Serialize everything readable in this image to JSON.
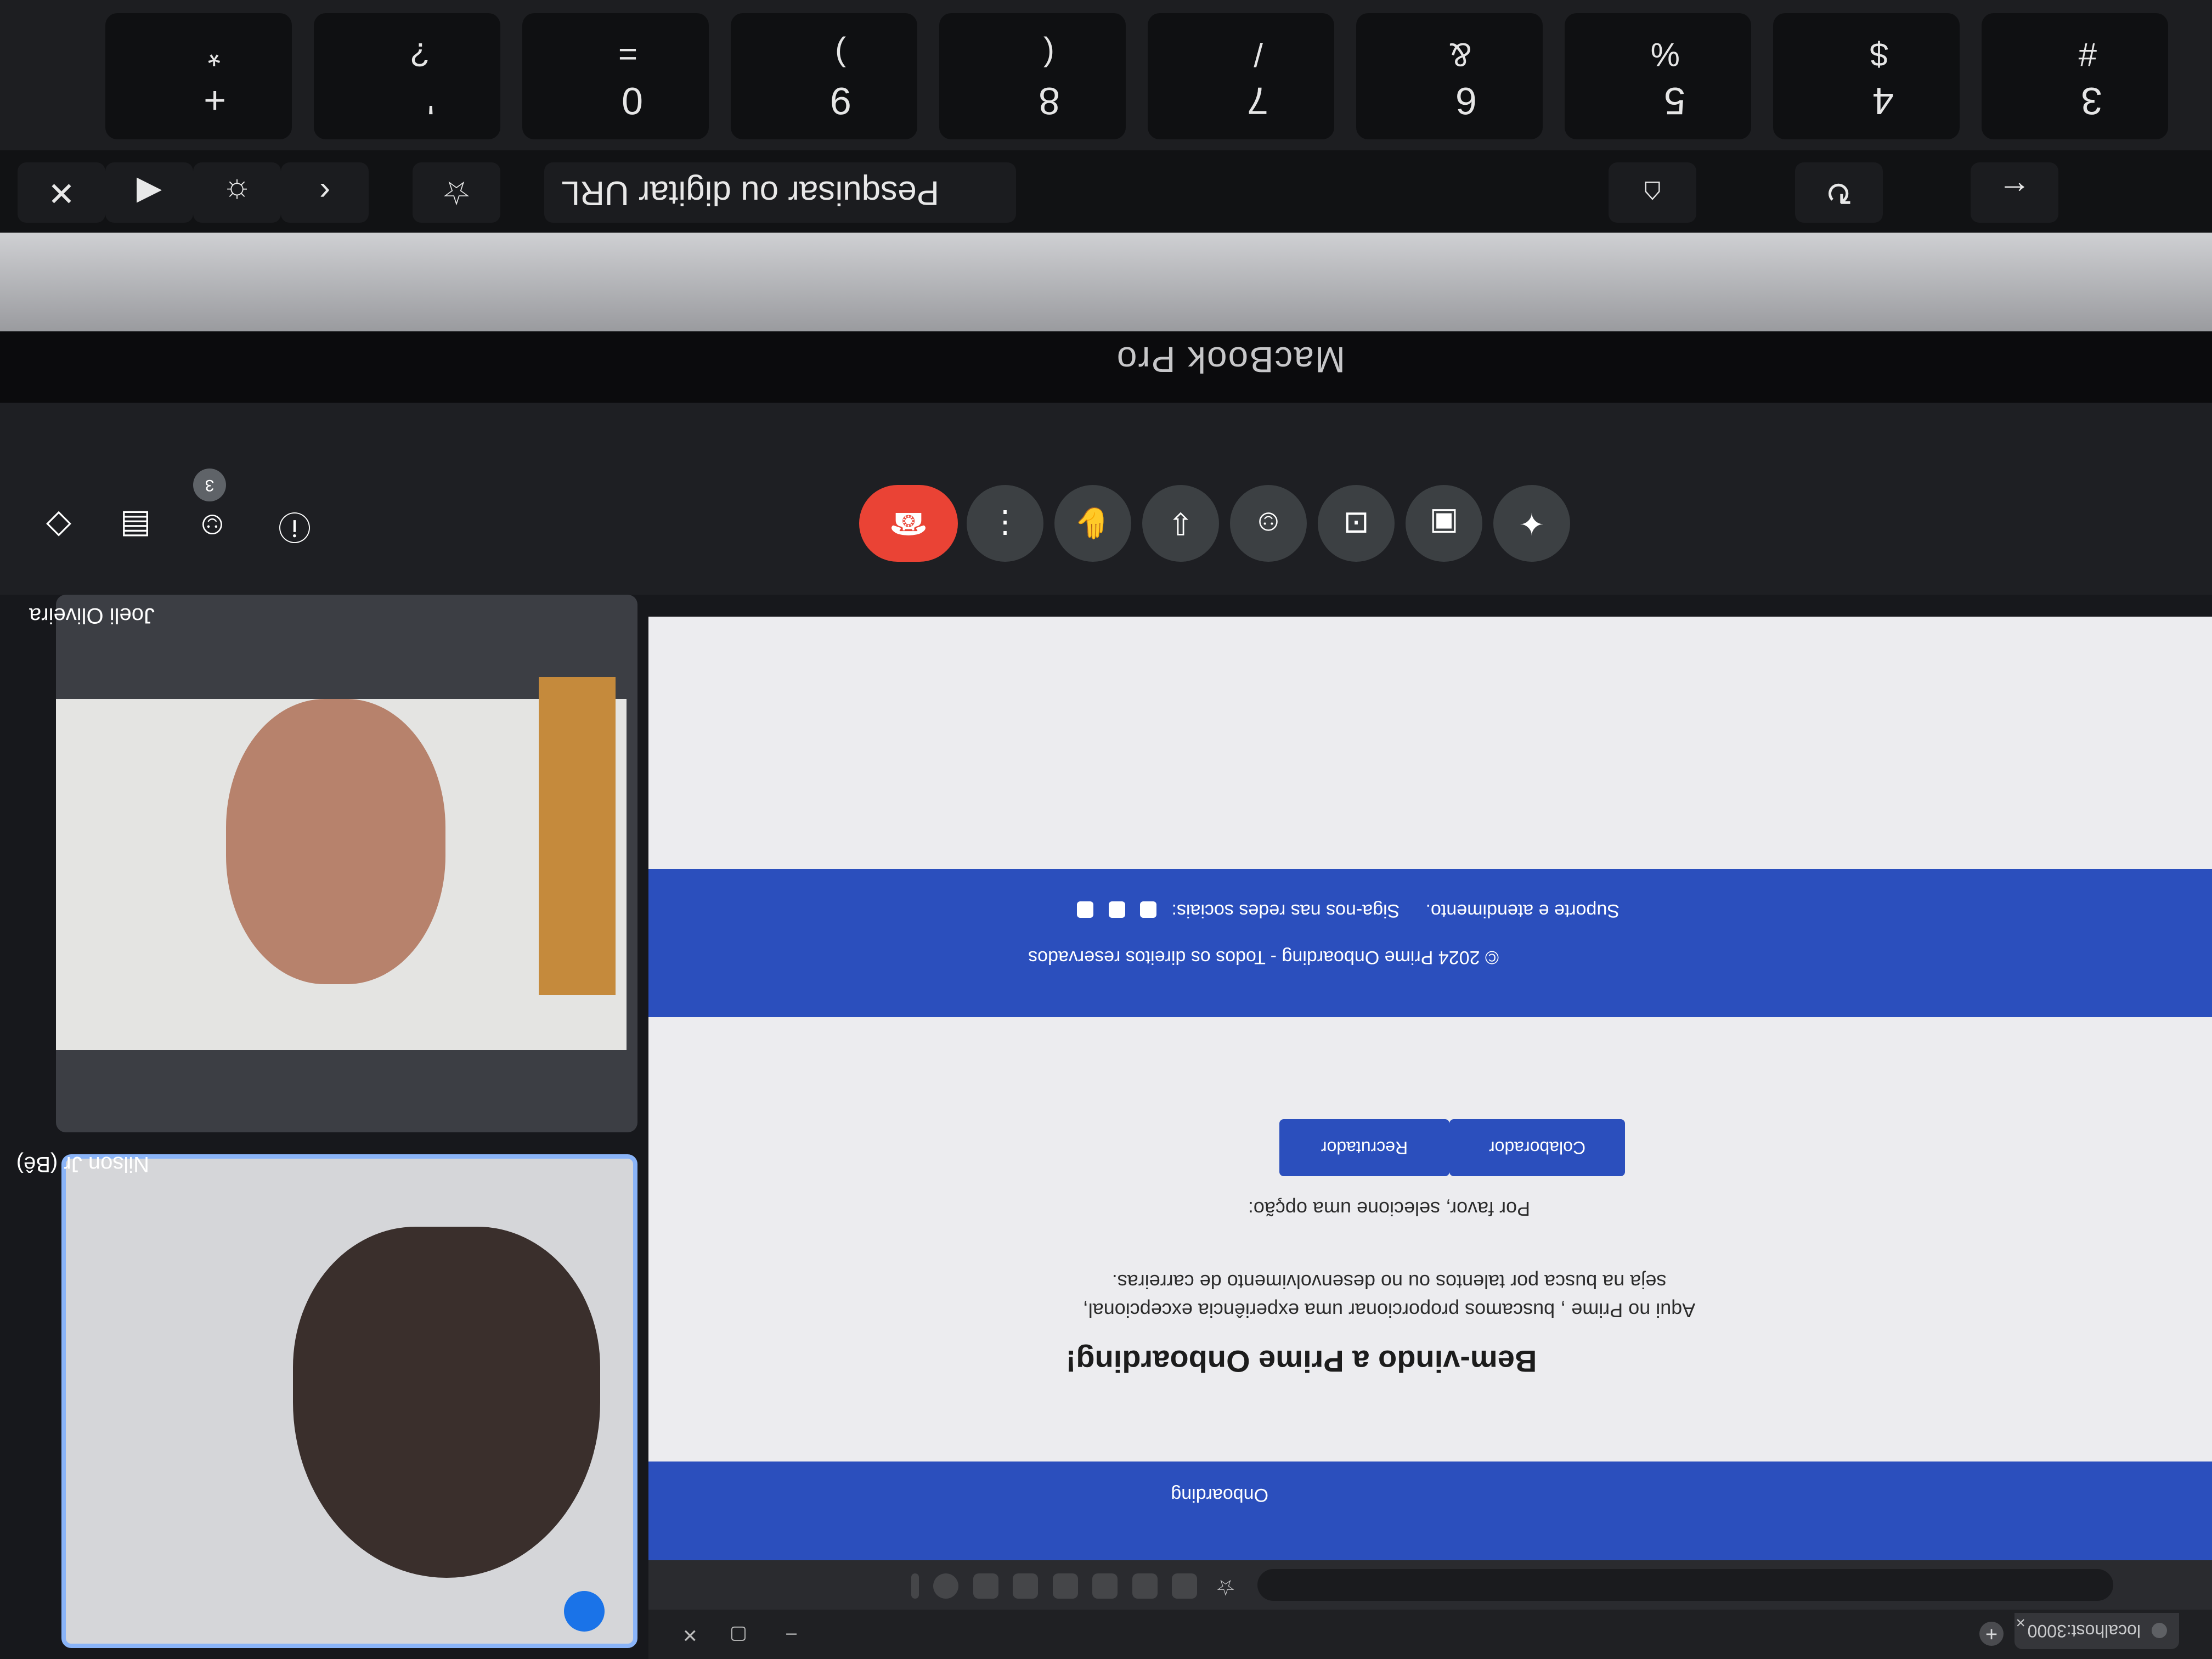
{
  "device": {
    "brand_label": "MacBook Pro"
  },
  "browser": {
    "tab_title": "localhost:3000",
    "omnibox_placeholder": "Pesquisar ou digitar URL"
  },
  "page": {
    "brand": "Onboarding",
    "hero_title": "Bem-vindo a Prime Onboarding!",
    "hero_description_line1": "Aqui no Prime , buscamos proporcionar uma experiência excepcional,",
    "hero_description_line2": "seja na busca por talentos ou no desenvolvimento de carreiras.",
    "prompt": "Por favor, selecione uma opção:",
    "buttons": {
      "recruiter": "Recrutador",
      "collaborator": "Colaborador"
    },
    "footer": {
      "support": "Suporte e atendimento.",
      "social": "Siga-nos nas redes sociais:",
      "copyright": "© 2024 Prime Onboarding - Todos os direitos reservados"
    }
  },
  "meet": {
    "participants": [
      {
        "name": "Nilson Jr (Bê)",
        "speaking": true
      },
      {
        "name": "Joeli Oliveira",
        "speaking": false
      }
    ],
    "people_count": "3",
    "controls": [
      "raise-hand-icon",
      "present-icon",
      "captions-icon",
      "emoji-icon",
      "download-icon",
      "hand-icon",
      "more-icon",
      "end-call-icon"
    ]
  },
  "keyboard": {
    "number_row": [
      {
        "top": "3",
        "bottom": "#"
      },
      {
        "top": "4",
        "bottom": "$"
      },
      {
        "top": "5",
        "bottom": "%"
      },
      {
        "top": "6",
        "bottom": "&"
      },
      {
        "top": "7",
        "bottom": "/"
      },
      {
        "top": "8",
        "bottom": "("
      },
      {
        "top": "9",
        "bottom": ")"
      },
      {
        "top": "0",
        "bottom": "="
      },
      {
        "top": "'",
        "bottom": "?"
      },
      {
        "top": "+",
        "bottom": "*"
      }
    ]
  }
}
